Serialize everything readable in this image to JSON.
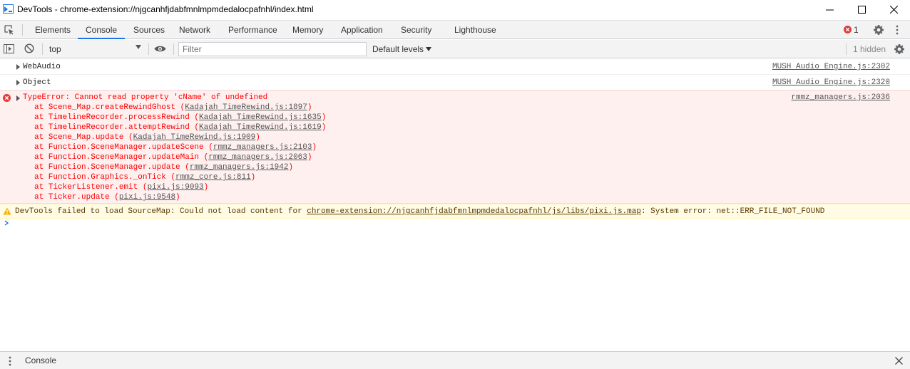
{
  "window": {
    "title": "DevTools - chrome-extension://njgcanhfjdabfmnlmpmdedalocpafnhl/index.html"
  },
  "tabs": [
    {
      "label": "Elements"
    },
    {
      "label": "Console"
    },
    {
      "label": "Sources"
    },
    {
      "label": "Network"
    },
    {
      "label": "Performance"
    },
    {
      "label": "Memory"
    },
    {
      "label": "Application"
    },
    {
      "label": "Security"
    },
    {
      "label": "Lighthouse"
    }
  ],
  "status": {
    "error_count": "1"
  },
  "toolbar": {
    "context": "top",
    "filter_placeholder": "Filter",
    "levels": "Default levels",
    "hidden": "1 hidden"
  },
  "messages": {
    "webaudio": {
      "text": "WebAudio",
      "source": "MUSH Audio Engine.js:2302"
    },
    "object": {
      "text": "Object",
      "source": "MUSH Audio Engine.js:2320"
    },
    "error": {
      "text": "TypeError: Cannot read property 'cName' of undefined",
      "source": "rmmz_managers.js:2036",
      "stack": [
        {
          "fn": "at Scene_Map.createRewindGhost (",
          "loc": "Kadajah TimeRewind.js:1897",
          "end": ")"
        },
        {
          "fn": "at TimelineRecorder.processRewind (",
          "loc": "Kadajah TimeRewind.js:1635",
          "end": ")"
        },
        {
          "fn": "at TimelineRecorder.attemptRewind (",
          "loc": "Kadajah TimeRewind.js:1619",
          "end": ")"
        },
        {
          "fn": "at Scene_Map.update (",
          "loc": "Kadajah TimeRewind.js:1909",
          "end": ")"
        },
        {
          "fn": "at Function.SceneManager.updateScene (",
          "loc": "rmmz_managers.js:2103",
          "end": ")"
        },
        {
          "fn": "at Function.SceneManager.updateMain (",
          "loc": "rmmz_managers.js:2063",
          "end": ")"
        },
        {
          "fn": "at Function.SceneManager.update (",
          "loc": "rmmz_managers.js:1942",
          "end": ")"
        },
        {
          "fn": "at Function.Graphics._onTick (",
          "loc": "rmmz_core.js:811",
          "end": ")"
        },
        {
          "fn": "at TickerListener.emit (",
          "loc": "pixi.js:9093",
          "end": ")"
        },
        {
          "fn": "at Ticker.update (",
          "loc": "pixi.js:9548",
          "end": ")"
        }
      ]
    },
    "warning": {
      "prefix": "DevTools failed to load SourceMap: Could not load content for ",
      "link": "chrome-extension://njgcanhfjdabfmnlmpmdedalocpafnhl/js/libs/pixi.js.map",
      "suffix": ": System error: net::ERR_FILE_NOT_FOUND"
    }
  },
  "drawer": {
    "tab": "Console"
  },
  "colors": {
    "accent": "#1a73e8",
    "error": "#ff0000",
    "error_bg": "#fff0f0",
    "warning_bg": "#fffbe5",
    "warning_icon": "#f4b400"
  },
  "icons": [
    "devtools-icon",
    "minimize-icon",
    "maximize-icon",
    "close-icon",
    "inspect-element-icon",
    "error-icon",
    "gear-icon",
    "kebab-menu-icon",
    "sidebar-toggle-icon",
    "clear-console-icon",
    "chevron-down-icon",
    "eye-icon",
    "warning-icon",
    "prompt-chevron-icon"
  ]
}
